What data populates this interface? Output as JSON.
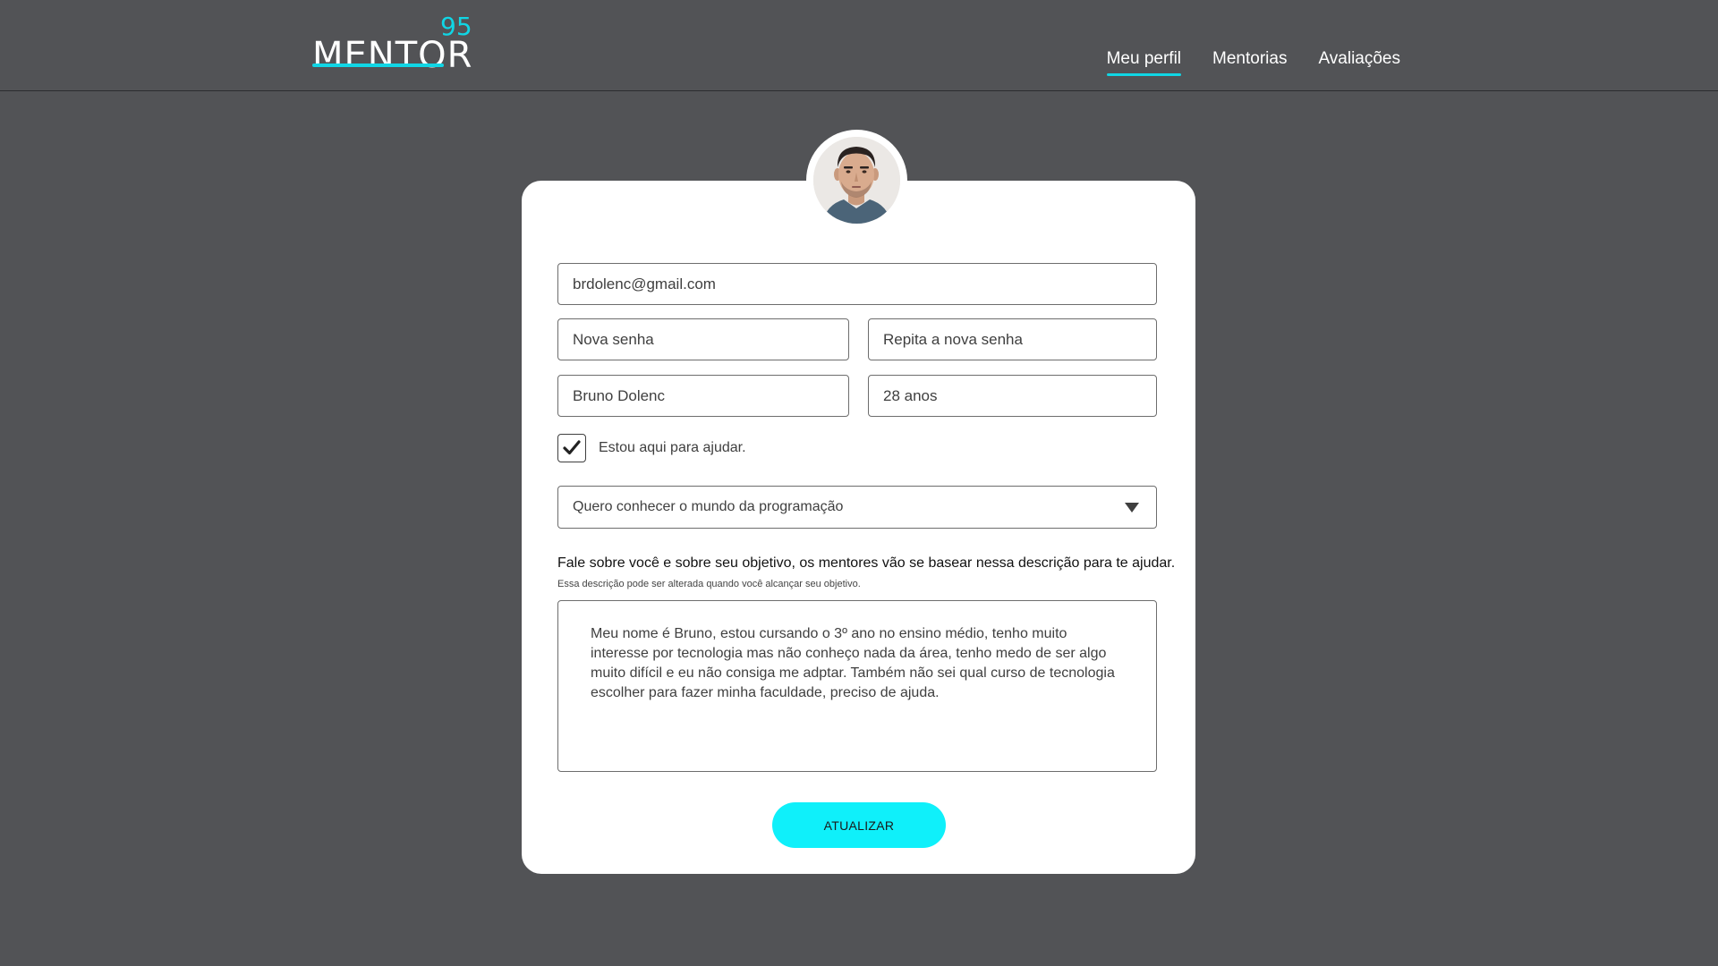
{
  "header": {
    "logo_text": "MENTOR",
    "logo_sup": "95",
    "nav": [
      {
        "label": "Meu perfil",
        "active": true
      },
      {
        "label": "Mentorias",
        "active": false
      },
      {
        "label": "Avaliações",
        "active": false
      }
    ]
  },
  "profile": {
    "email_value": "brdolenc@gmail.com",
    "new_password_placeholder": "Nova senha",
    "repeat_password_placeholder": "Repita a nova senha",
    "name_value": "Bruno Dolenc",
    "age_value": "28 anos",
    "help_checkbox_label": "Estou aqui para ajudar.",
    "help_checked": true,
    "goal_select_value": "Quero conhecer o mundo da programação",
    "description_title": "Fale sobre você e sobre seu objetivo, os mentores vão se basear nessa descrição para te ajudar.",
    "description_subtitle": "Essa descrição pode ser alterada quando você alcançar seu objetivo.",
    "description_text": "Meu nome é Bruno, estou cursando o 3º ano no ensino médio, tenho muito interesse por tecnologia mas não conheço nada da área, tenho medo de ser algo muito difícil e eu não consiga me adptar. Também não sei qual curso de tecnologia escolher para fazer minha faculdade, preciso de ajuda.",
    "submit_label": "ATUALIZAR"
  },
  "colors": {
    "background": "#525356",
    "accent": "#10d6e5",
    "button": "#0ff0fa",
    "card": "#ffffff"
  }
}
